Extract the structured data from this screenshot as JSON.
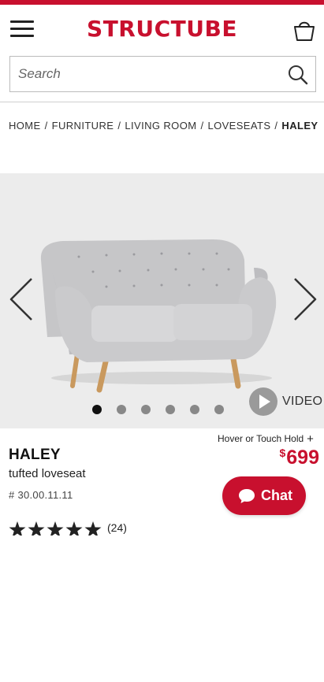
{
  "brand": {
    "logo_text": "STRUCTUBE",
    "accent": "#c8102e"
  },
  "header": {
    "menu_icon": "hamburger-icon",
    "cart_icon": "shopping-bag-icon",
    "search": {
      "placeholder": "Search",
      "value": "",
      "icon": "search-icon"
    }
  },
  "breadcrumb": {
    "items": [
      "HOME",
      "FURNITURE",
      "LIVING ROOM",
      "LOVESEATS"
    ],
    "current": "HALEY",
    "separator": "/"
  },
  "gallery": {
    "image": "grey-tufted-loveseat",
    "prev_icon": "chevron-left-icon",
    "next_icon": "chevron-right-icon",
    "slide_count": 6,
    "active_slide": 1,
    "video_label": "VIDEO",
    "video_icon": "play-icon"
  },
  "product": {
    "hover_hint": "Hover or Touch Hold",
    "hover_hint_icon": "plus-icon",
    "name": "HALEY",
    "subtitle": "tufted loveseat",
    "sku": "# 30.00.11.11",
    "price_currency": "$",
    "price_value": "699",
    "rating": {
      "stars": 5,
      "count_label": "(24)"
    }
  },
  "chat": {
    "label": "Chat",
    "icon": "chat-bubble-icon"
  }
}
